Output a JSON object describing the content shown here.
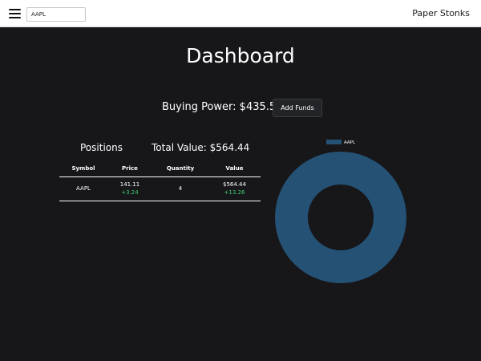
{
  "navbar": {
    "search_value": "AAPL",
    "brand": "Paper Stonks"
  },
  "main": {
    "title": "Dashboard",
    "buying_power": "Buying Power: $435.56",
    "add_funds_label": "Add Funds",
    "positions_title": "Positions",
    "total_value": "Total Value: $564.44"
  },
  "table": {
    "headers": [
      "Symbol",
      "Price",
      "Quantity",
      "Value"
    ],
    "rows": [
      {
        "symbol": "AAPL",
        "price": "141.11",
        "price_change": "+3.24",
        "quantity": "4",
        "value": "$564.44",
        "value_change": "+13.26"
      }
    ]
  },
  "colors": {
    "background": "#171619",
    "navbar": "#ffffff",
    "gain": "#3fcf73",
    "chart_slice": "#245174"
  },
  "chart_data": {
    "type": "pie",
    "categories": [
      "AAPL"
    ],
    "values": [
      564.44
    ],
    "legend_position": "top",
    "colors": [
      "#245174"
    ]
  }
}
